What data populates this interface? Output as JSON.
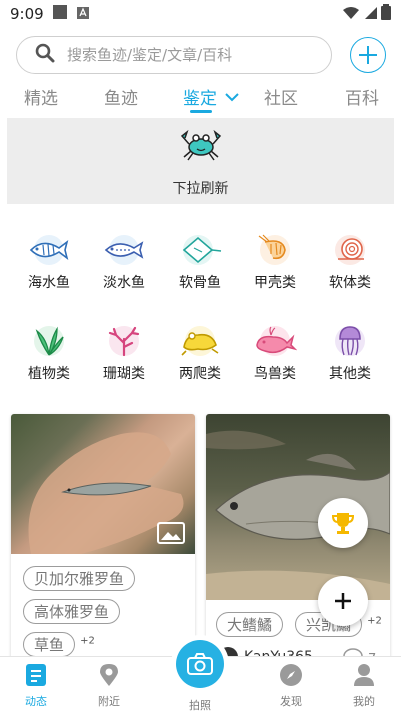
{
  "status_bar": {
    "time": "9:09"
  },
  "search": {
    "placeholder": "搜索鱼迹/鉴定/文章/百科"
  },
  "tabs": [
    {
      "label": "精选"
    },
    {
      "label": "鱼迹"
    },
    {
      "label": "鉴定"
    },
    {
      "label": "社区"
    },
    {
      "label": "百科"
    }
  ],
  "refresh": {
    "label": "下拉刷新"
  },
  "categories": [
    {
      "label": "海水鱼",
      "icon": "saltwater-fish-icon"
    },
    {
      "label": "淡水鱼",
      "icon": "freshwater-fish-icon"
    },
    {
      "label": "软骨鱼",
      "icon": "ray-icon"
    },
    {
      "label": "甲壳类",
      "icon": "shrimp-icon"
    },
    {
      "label": "软体类",
      "icon": "shell-icon"
    },
    {
      "label": "植物类",
      "icon": "plant-icon"
    },
    {
      "label": "珊瑚类",
      "icon": "coral-icon"
    },
    {
      "label": "两爬类",
      "icon": "frog-icon"
    },
    {
      "label": "鸟兽类",
      "icon": "whale-icon"
    },
    {
      "label": "其他类",
      "icon": "jellyfish-icon"
    }
  ],
  "cards": {
    "left": {
      "tags": [
        "贝加尔雅罗鱼",
        "高体雅罗鱼",
        "草鱼"
      ],
      "more_count": "+2"
    },
    "right": {
      "tags": [
        "大鳍鱊",
        "兴凯鱊"
      ],
      "more_count": "+2",
      "username": "KanYu365",
      "comment_count": "7"
    }
  },
  "bottom_nav": [
    {
      "label": "动态"
    },
    {
      "label": "附近"
    },
    {
      "label": "拍照"
    },
    {
      "label": "发现"
    },
    {
      "label": "我的"
    }
  ],
  "colors": {
    "accent": "#1aa9e0",
    "trophy": "#f5b800"
  }
}
